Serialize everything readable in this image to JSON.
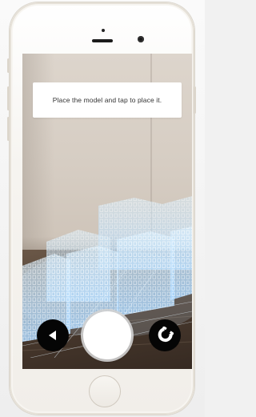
{
  "prompt": {
    "text": "Place the model and tap to place it."
  },
  "controls": {
    "back_icon": "triangle-left-icon",
    "capture_icon": "shutter-circle",
    "magnet_icon": "magnet-icon"
  },
  "colors": {
    "button_dark": "#050505",
    "shutter": "#ffffff",
    "hologram": "#bfe3ff",
    "wall": "#d6cdc3",
    "table": "#4a3a2e",
    "phone_body": "#f6f4f0"
  }
}
